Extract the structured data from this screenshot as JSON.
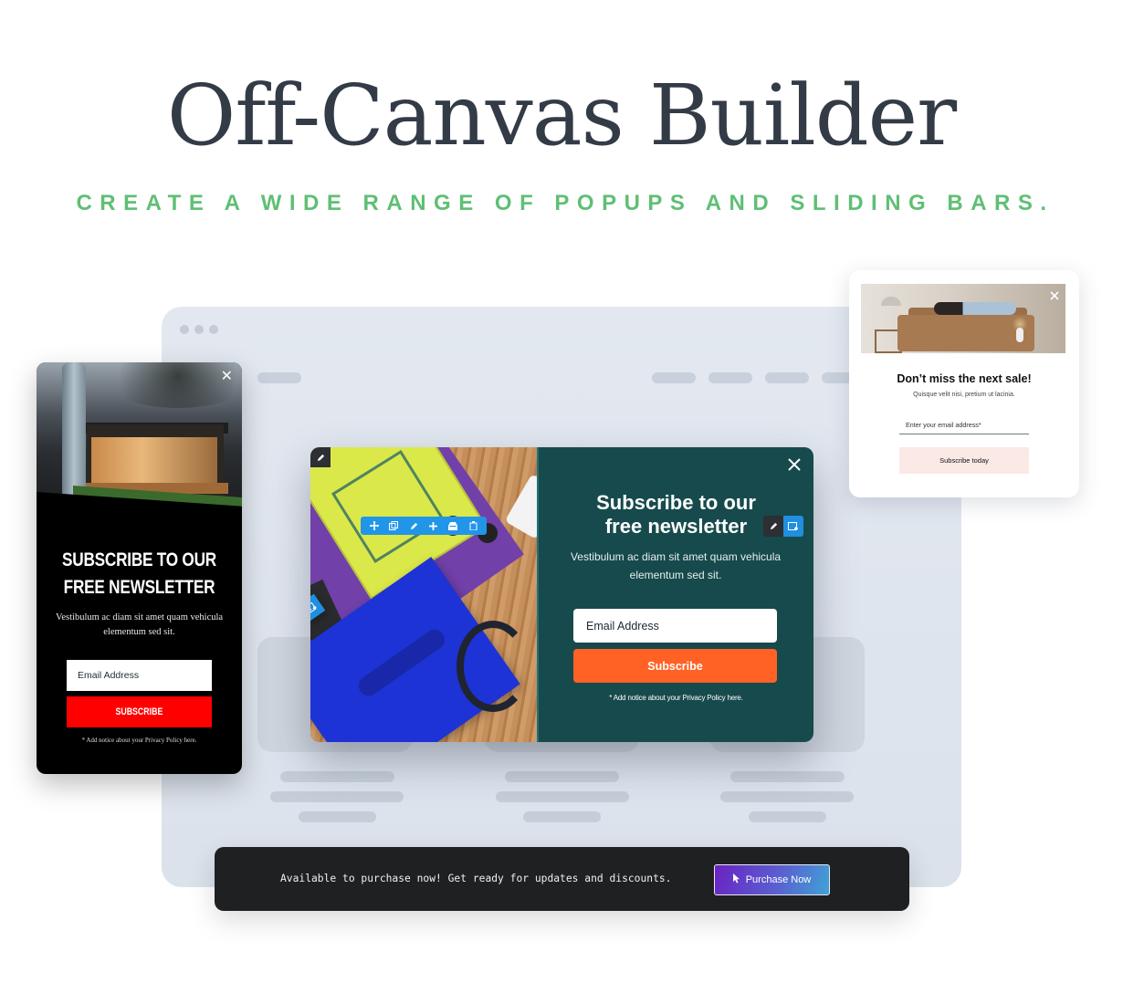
{
  "hero": {
    "title": "Off-Canvas Builder",
    "subtitle": "CREATE A WIDE RANGE OF POPUPS AND SLIDING BARS."
  },
  "colors": {
    "title": "#333b46",
    "subtitle_accent": "#5fbf74",
    "center_popup_bg": "#174a4c",
    "center_subscribe": "#ff6224",
    "left_subscribe": "#ff0000",
    "editor_blue": "#1f8fe0",
    "right_button_bg": "#fbe9e6",
    "bar_bg": "#1f2022"
  },
  "left_popup": {
    "close_icon": "close-icon",
    "heading_line1": "SUBSCRIBE TO OUR",
    "heading_line2": "FREE NEWSLETTER",
    "description": "Vestibulum ac diam sit amet quam vehicula elementum sed sit.",
    "email_placeholder": "Email Address",
    "button_label": "SUBSCRIBE",
    "notice": "* Add notice about your Privacy Policy here."
  },
  "center_popup": {
    "heading_line1": "Subscribe to our",
    "heading_line2": "free newsletter",
    "description": "Vestibulum ac diam sit amet quam vehicula elementum sed sit.",
    "email_placeholder": "Email Address",
    "button_label": "Subscribe",
    "notice": "* Add notice about your Privacy Policy here.",
    "image_toolbar": [
      "move-icon",
      "duplicate-icon",
      "edit-icon",
      "add-icon",
      "save-icon",
      "delete-icon"
    ],
    "corner_tools": [
      "edit-icon",
      "add-section-icon"
    ],
    "heading_tools": [
      "edit-icon",
      "add-section-icon"
    ]
  },
  "right_popup": {
    "heading": "Don’t miss the next sale!",
    "description": "Quisque velit nisi, pretium ut lacinia.",
    "email_placeholder": "Enter your email address*",
    "button_label": "Subscribe today"
  },
  "bottom_bar": {
    "message": "Available to purchase now! Get ready for updates and discounts.",
    "button_label": "Purchase Now",
    "button_icon": "cursor-icon"
  }
}
